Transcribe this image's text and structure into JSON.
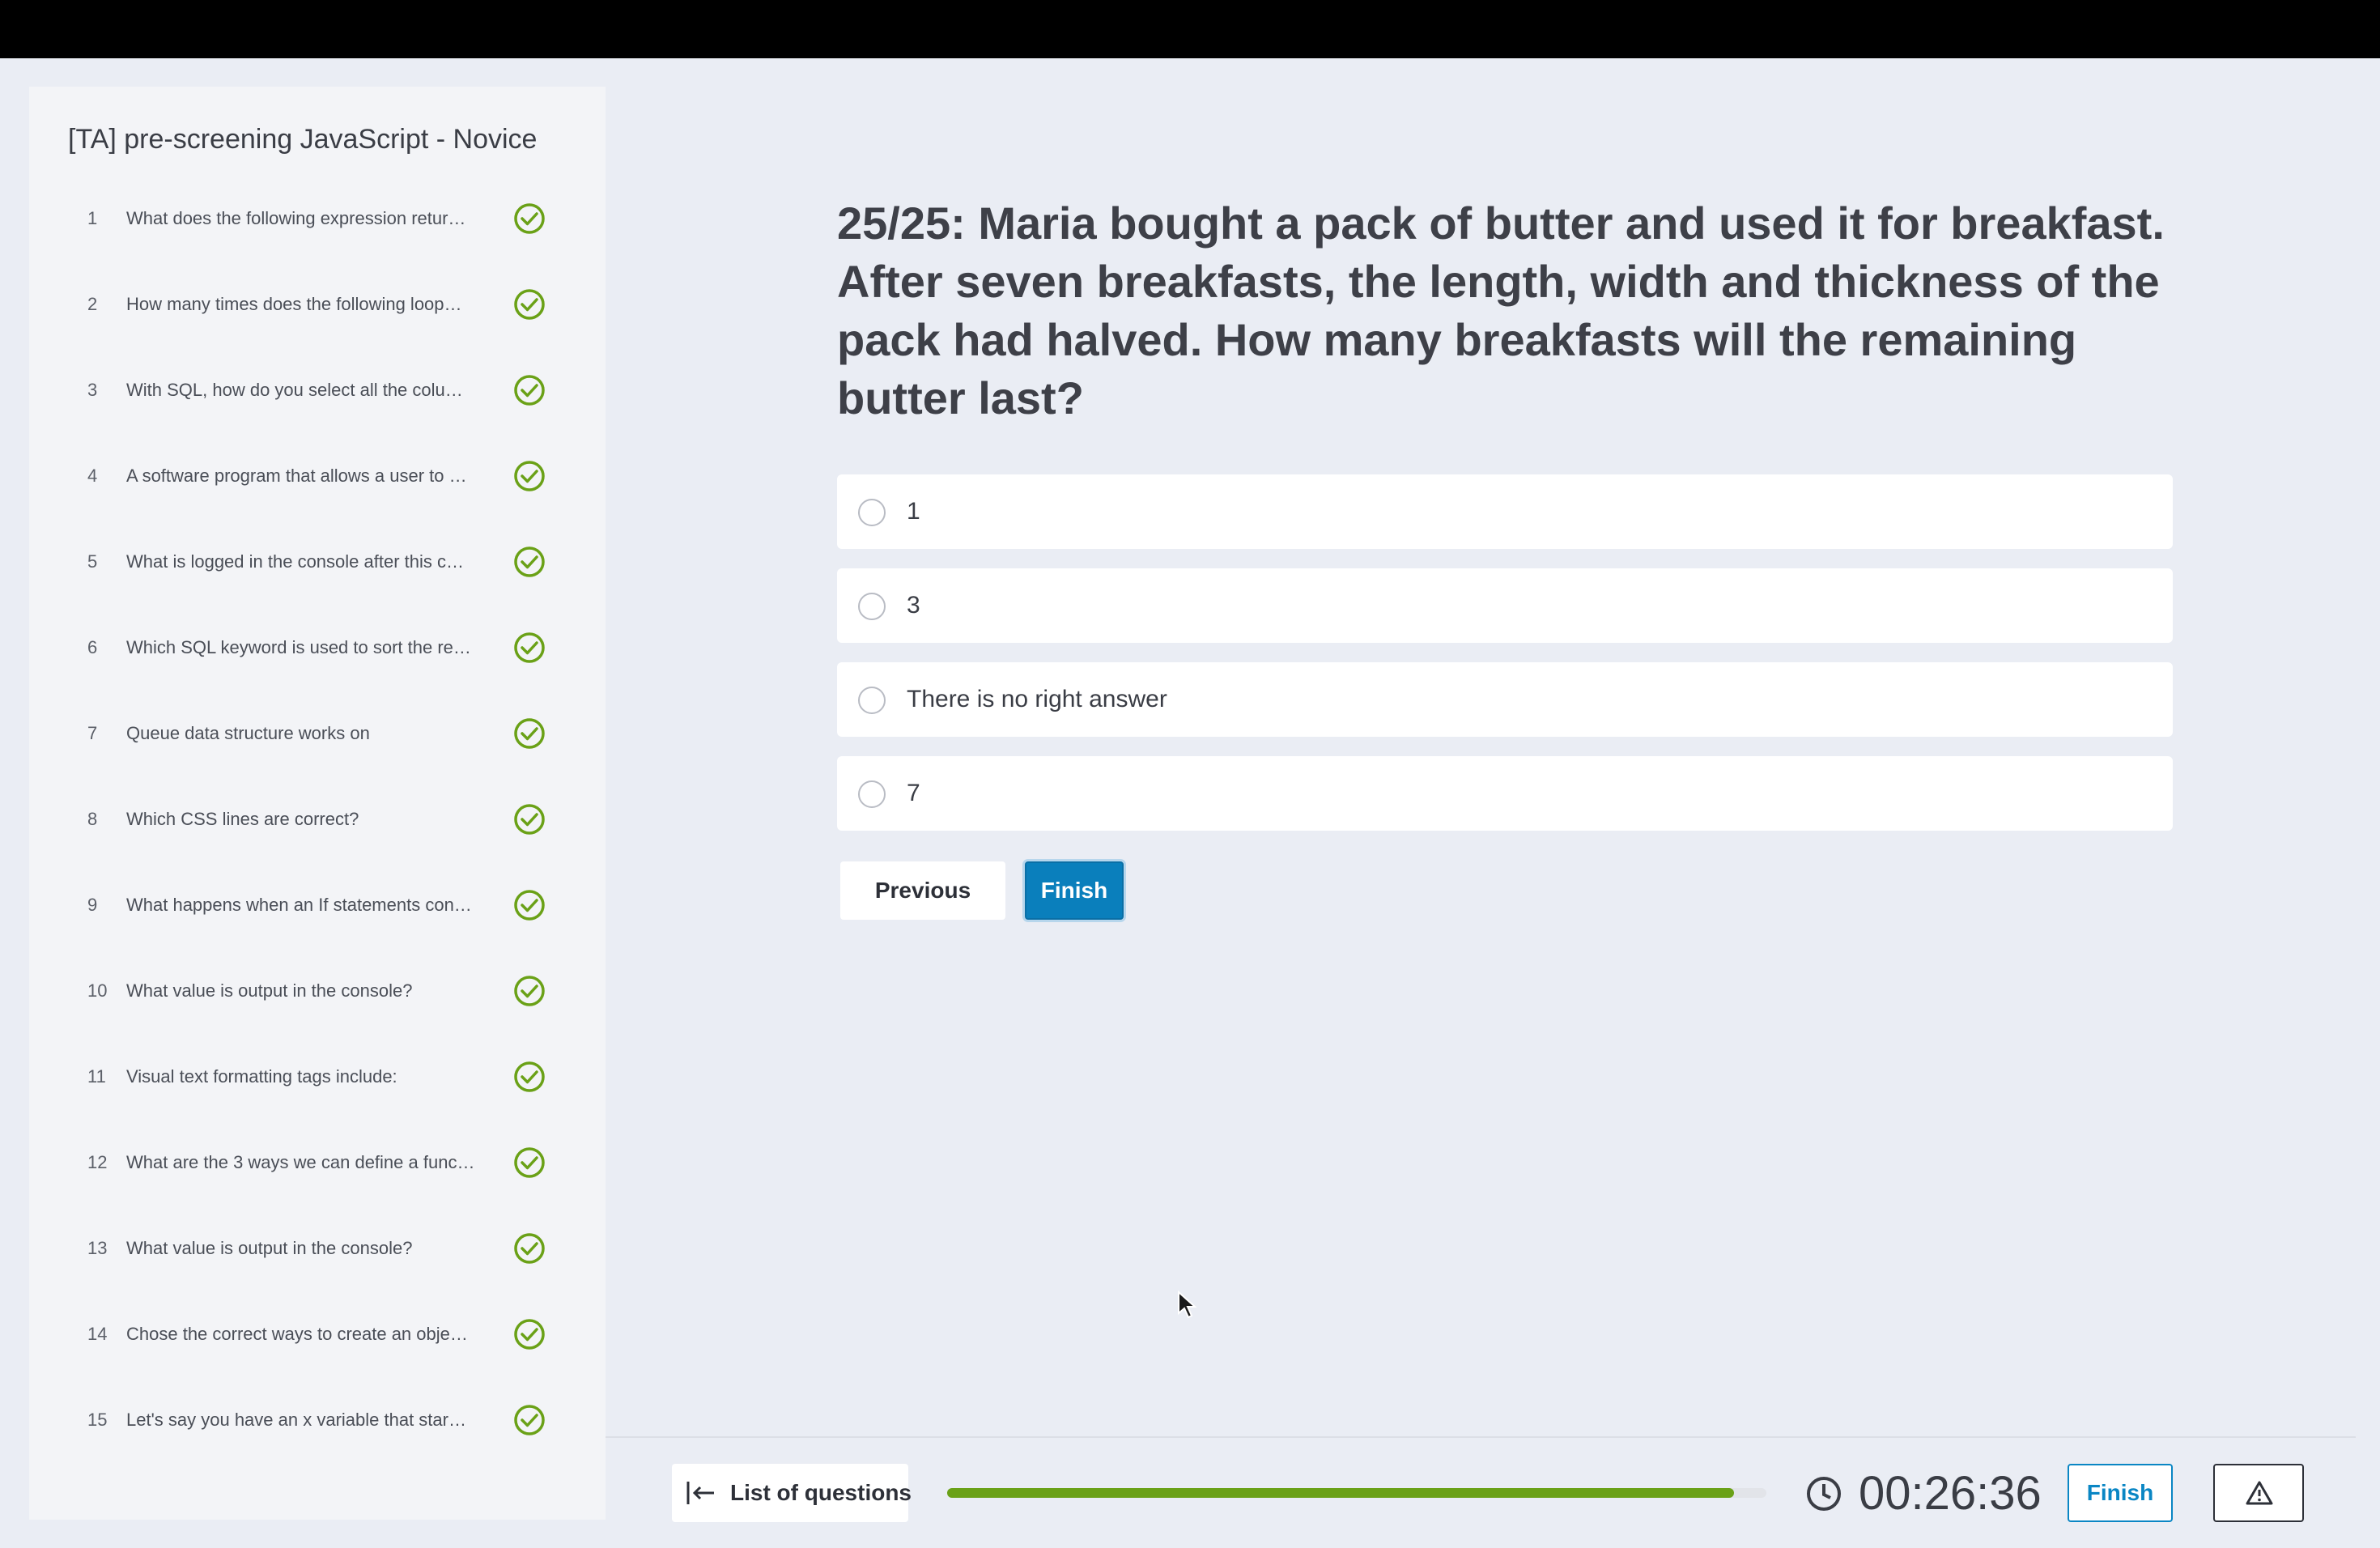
{
  "sidebar": {
    "title": "[TA] pre-screening JavaScript - Novice",
    "items": [
      {
        "num": "1",
        "text": "What does the following expression retur…",
        "status_icon": "check-circle-icon"
      },
      {
        "num": "2",
        "text": "How many times does the following loop…",
        "status_icon": "check-circle-icon"
      },
      {
        "num": "3",
        "text": "With SQL, how do you select all the colu…",
        "status_icon": "check-circle-icon"
      },
      {
        "num": "4",
        "text": "A software program that allows a user to …",
        "status_icon": "check-circle-icon"
      },
      {
        "num": "5",
        "text": "What is logged in the console after this c…",
        "status_icon": "check-circle-icon"
      },
      {
        "num": "6",
        "text": "Which SQL keyword is used to sort the re…",
        "status_icon": "check-circle-icon"
      },
      {
        "num": "7",
        "text": "Queue data structure works on",
        "status_icon": "check-circle-icon"
      },
      {
        "num": "8",
        "text": "Which CSS lines are correct?",
        "status_icon": "check-circle-icon"
      },
      {
        "num": "9",
        "text": "What happens when an If statements con…",
        "status_icon": "check-circle-icon"
      },
      {
        "num": "10",
        "text": "What value is output in the console?",
        "status_icon": "check-circle-icon"
      },
      {
        "num": "11",
        "text": "Visual text formatting tags include:",
        "status_icon": "check-circle-icon"
      },
      {
        "num": "12",
        "text": "What are the 3 ways we can define a func…",
        "status_icon": "check-circle-icon"
      },
      {
        "num": "13",
        "text": "What value is output in the console?",
        "status_icon": "check-circle-icon"
      },
      {
        "num": "14",
        "text": "Chose the correct ways to create an obje…",
        "status_icon": "check-circle-icon"
      },
      {
        "num": "15",
        "text": "Let's say you have an x variable that star…",
        "status_icon": "check-circle-icon"
      }
    ]
  },
  "question": {
    "text": "25/25: Maria bought a pack of butter and used it for breakfast. After seven breakfasts, the length, width and thickness of the pack had halved. How many breakfasts will the remaining butter last?",
    "options": [
      "1",
      "3",
      "There is no right answer",
      "7"
    ]
  },
  "actions": {
    "previous_label": "Previous",
    "finish_label": "Finish"
  },
  "footer": {
    "list_label": "List of questions",
    "progress": 0.96,
    "timer": "00:26:36",
    "finish_label": "Finish",
    "report_icon": "warning-icon"
  },
  "colors": {
    "accent": "#0a7fbc",
    "success": "#6aa117",
    "background": "#eaedf4"
  }
}
